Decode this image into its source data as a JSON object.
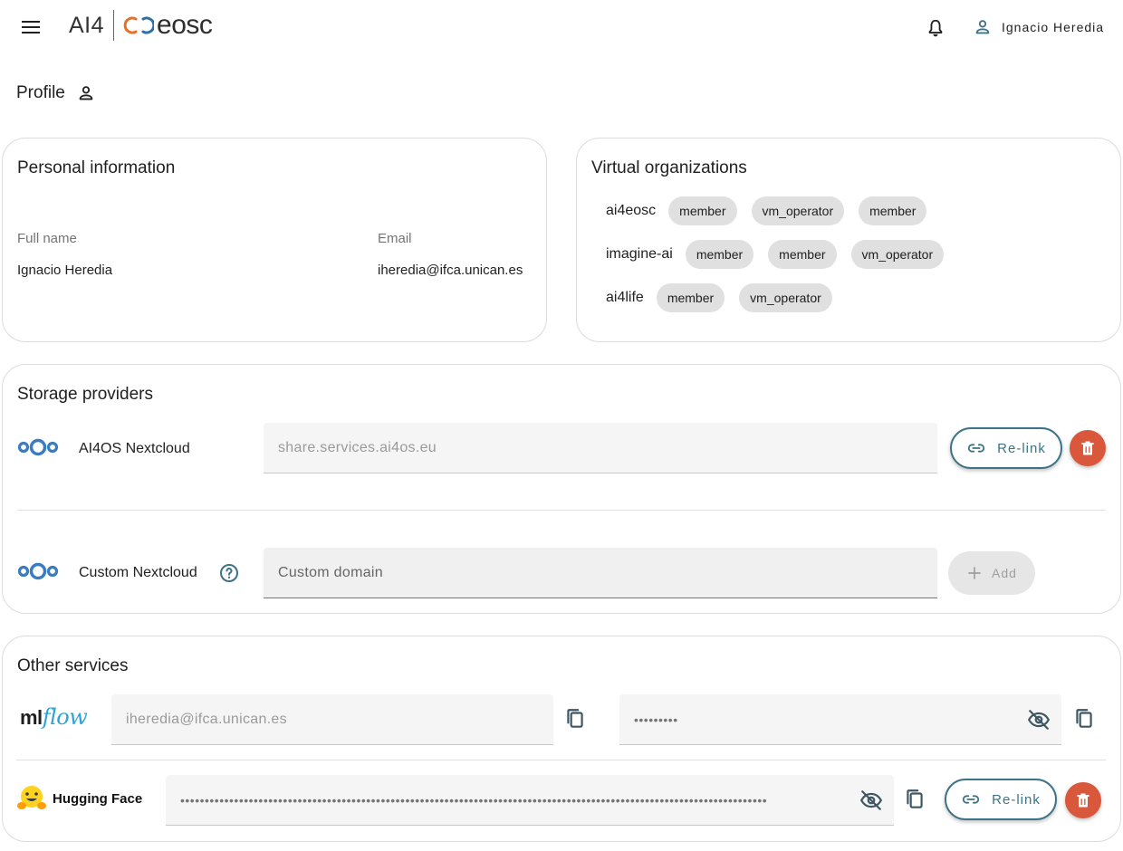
{
  "header": {
    "brand_ai4": "AI4",
    "brand_eosc": "eosc",
    "user_name": "Ignacio Heredia"
  },
  "page": {
    "title": "Profile"
  },
  "personal_info": {
    "title": "Personal information",
    "full_name_label": "Full name",
    "full_name_value": "Ignacio Heredia",
    "email_label": "Email",
    "email_value": "iheredia@ifca.unican.es"
  },
  "virtual_orgs": {
    "title": "Virtual organizations",
    "rows": [
      {
        "name": "ai4eosc",
        "roles": [
          "member",
          "vm_operator",
          "member"
        ]
      },
      {
        "name": "imagine-ai",
        "roles": [
          "member",
          "member",
          "vm_operator"
        ]
      },
      {
        "name": "ai4life",
        "roles": [
          "member",
          "vm_operator"
        ]
      }
    ]
  },
  "storage": {
    "title": "Storage providers",
    "ai4os": {
      "name": "AI4OS Nextcloud",
      "value": "share.services.ai4os.eu",
      "relink_label": "Re-link"
    },
    "custom": {
      "name": "Custom Nextcloud",
      "placeholder": "Custom domain",
      "add_label": "Add"
    }
  },
  "other_services": {
    "title": "Other services",
    "mlflow": {
      "logo_ml": "ml",
      "logo_flow": "flow",
      "username": "iheredia@ifca.unican.es",
      "password_mask": "•••••••••"
    },
    "huggingface": {
      "name": "Hugging Face",
      "token_mask": "••••••••••••••••••••••••••••••••••••••••••••••••••••••••••••••••••••••••••••••••••••••••••••••••••••••••••••••••••••••••",
      "relink_label": "Re-link"
    }
  },
  "colors": {
    "accent": "#3e7385",
    "danger": "#d9573a",
    "chip_bg": "#e0e0e0",
    "nextcloud_blue": "#0082c9",
    "mlflow_blue": "#2aa4d6"
  },
  "icons": {
    "menu": "menu-icon",
    "bell": "bell-icon",
    "user": "person-icon",
    "link": "link-icon",
    "delete": "trash-icon",
    "copy": "copy-icon",
    "eye_off": "eye-off-icon",
    "help": "help-circle-icon",
    "add": "plus-icon"
  }
}
